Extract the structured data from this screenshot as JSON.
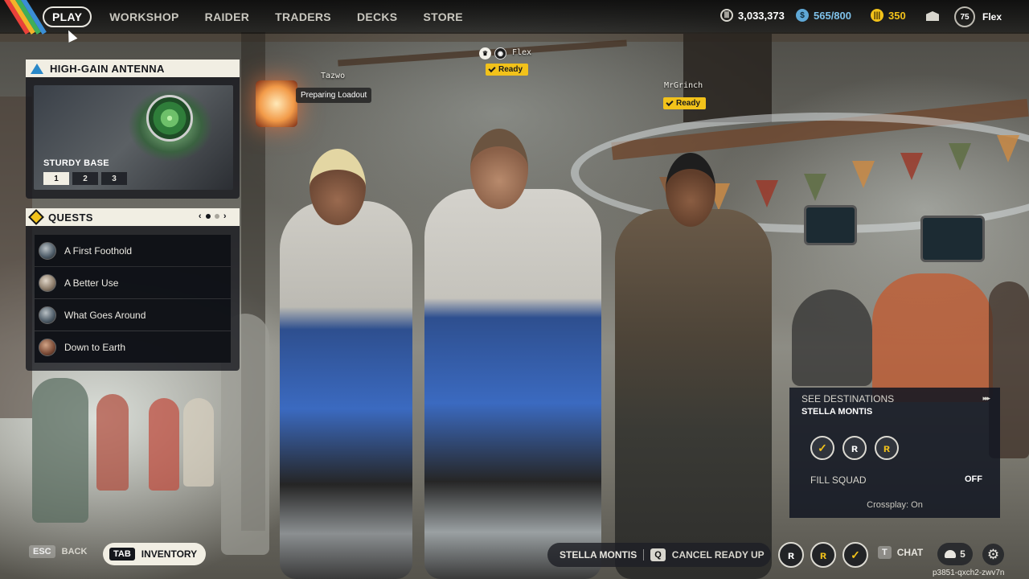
{
  "nav": {
    "items": [
      "PLAY",
      "WORKSHOP",
      "RAIDER",
      "TRADERS",
      "DECKS",
      "STORE"
    ],
    "active": "PLAY"
  },
  "currencies": {
    "credits": "3,033,373",
    "tokens": "565/800",
    "coins": "350"
  },
  "profile": {
    "level": "75",
    "name": "Flex"
  },
  "party": {
    "members": [
      {
        "name": "Tazwo",
        "status": "Preparing Loadout"
      },
      {
        "name": "Flex",
        "status": "Ready"
      },
      {
        "name": "MrGrinch",
        "status": "Ready"
      }
    ]
  },
  "antenna": {
    "title": "HIGH-GAIN ANTENNA",
    "subtitle": "STURDY BASE",
    "levels": [
      "1",
      "2",
      "3"
    ],
    "active_level": "1"
  },
  "quests": {
    "title": "QUESTS",
    "prev": "‹",
    "next": "›",
    "items": [
      "A First Foothold",
      "A Better Use",
      "What Goes Around",
      "Down to Earth"
    ]
  },
  "destinations": {
    "title": "SEE DESTINATIONS",
    "name": "STELLA MONTIS",
    "arrows": "▸▸▸",
    "fill_label": "FILL SQUAD",
    "fill_value": "OFF",
    "crossplay": "Crossplay: On"
  },
  "bottom": {
    "esc_key": "ESC",
    "back": "BACK",
    "tab_key": "TAB",
    "inventory": "INVENTORY",
    "destination": "STELLA MONTIS",
    "q_key": "Q",
    "cancel_ready": "CANCEL READY UP",
    "t_key": "T",
    "chat": "CHAT",
    "friends_count": "5",
    "session_id": "p3851-qxch2-zwv7n"
  },
  "colors": {
    "accent_yellow": "#f2c21a",
    "panel_cream": "#f1eee3",
    "panel_dark": "#14161b"
  },
  "icons": {
    "credits": "credits-icon",
    "tokens": "token-icon",
    "coins": "coins-icon",
    "mail": "mail-icon",
    "settings": "gear-icon",
    "friends": "people-icon"
  }
}
